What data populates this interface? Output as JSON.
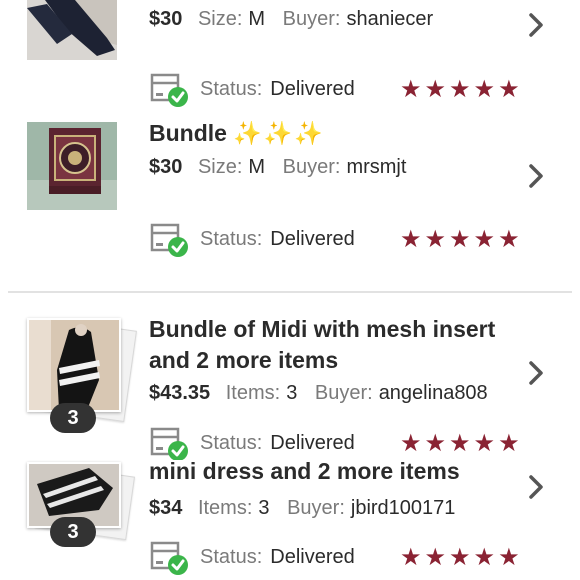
{
  "colors": {
    "star": "#8a2333",
    "check": "#3bb54a",
    "chevron": "#555555"
  },
  "orders": [
    {
      "title": "",
      "price": "$30",
      "detail_label": "Size:",
      "detail_value": "M",
      "buyer_label": "Buyer:",
      "buyer": "shaniecer",
      "status_label": "Status:",
      "status": "Delivered",
      "rating": 5
    },
    {
      "title": "Bundle",
      "title_emoji": "✨✨✨",
      "price": "$30",
      "detail_label": "Size:",
      "detail_value": "M",
      "buyer_label": "Buyer:",
      "buyer": "mrsmjt",
      "status_label": "Status:",
      "status": "Delivered",
      "rating": 5
    },
    {
      "title": "Bundle of Midi with mesh insert and 2 more items",
      "price": "$43.35",
      "detail_label": "Items:",
      "detail_value": "3",
      "buyer_label": "Buyer:",
      "buyer": "angelina808",
      "status_label": "Status:",
      "status": "Delivered",
      "rating": 5,
      "item_count": "3"
    },
    {
      "title": "mini dress and 2 more items",
      "price": "$34",
      "detail_label": "Items:",
      "detail_value": "3",
      "buyer_label": "Buyer:",
      "buyer": "jbird100171",
      "status_label": "Status:",
      "status": "Delivered",
      "rating": 5,
      "item_count": "3"
    }
  ]
}
